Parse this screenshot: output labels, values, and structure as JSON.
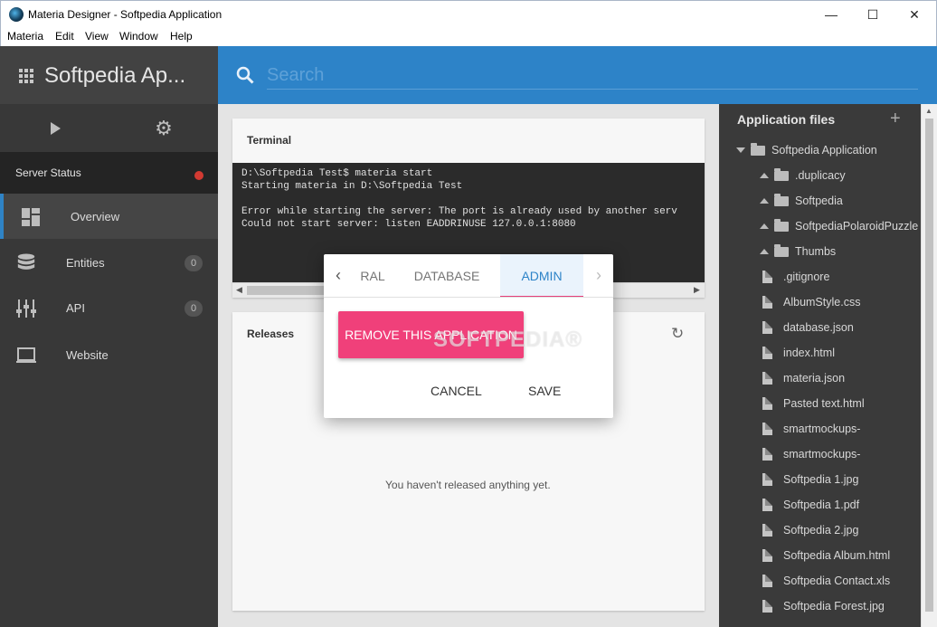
{
  "window": {
    "title": "Materia Designer - Softpedia Application",
    "controls": {
      "minimize": "—",
      "maximize": "☐",
      "close": "✕"
    }
  },
  "menu": [
    "Materia",
    "Edit",
    "View",
    "Window",
    "Help"
  ],
  "sidebar": {
    "app_title": "Softpedia Ap...",
    "server_status_label": "Server Status",
    "server_status_color": "#d23a32",
    "items": [
      {
        "label": "Overview",
        "icon": "dashboard-icon",
        "active": true
      },
      {
        "label": "Entities",
        "icon": "database-icon",
        "badge": "0"
      },
      {
        "label": "API",
        "icon": "api-icon",
        "badge": "0"
      },
      {
        "label": "Website",
        "icon": "monitor-icon"
      }
    ]
  },
  "search": {
    "placeholder": "Search"
  },
  "terminal": {
    "title": "Terminal",
    "lines": [
      "D:\\Softpedia Test$ materia start",
      "Starting materia in D:\\Softpedia Test",
      "",
      "Error while starting the server: The port is already used by another serv",
      "Could not start server: listen EADDRINUSE 127.0.0.1:8080"
    ]
  },
  "releases": {
    "title": "Releases",
    "empty_text": "You haven't released anything yet."
  },
  "files": {
    "title": "Application files",
    "tree": [
      {
        "name": "Softpedia Application",
        "type": "folder",
        "level": 0,
        "expanded": true
      },
      {
        "name": ".duplicacy",
        "type": "folder",
        "level": 1
      },
      {
        "name": "Softpedia",
        "type": "folder",
        "level": 1
      },
      {
        "name": "SoftpediaPolaroidPuzzle",
        "type": "folder",
        "level": 1
      },
      {
        "name": "Thumbs",
        "type": "folder",
        "level": 1
      },
      {
        "name": ".gitignore",
        "type": "file",
        "level": 1
      },
      {
        "name": "AlbumStyle.css",
        "type": "file",
        "level": 1
      },
      {
        "name": "database.json",
        "type": "file",
        "level": 1
      },
      {
        "name": "index.html",
        "type": "file",
        "level": 1
      },
      {
        "name": "materia.json",
        "type": "file",
        "level": 1
      },
      {
        "name": "Pasted text.html",
        "type": "file",
        "level": 1
      },
      {
        "name": "smartmockups-",
        "type": "file",
        "level": 1
      },
      {
        "name": "smartmockups-",
        "type": "file",
        "level": 1
      },
      {
        "name": "Softpedia 1.jpg",
        "type": "file",
        "level": 1
      },
      {
        "name": "Softpedia 1.pdf",
        "type": "file",
        "level": 1
      },
      {
        "name": "Softpedia 2.jpg",
        "type": "file",
        "level": 1
      },
      {
        "name": "Softpedia Album.html",
        "type": "file",
        "level": 1
      },
      {
        "name": "Softpedia Contact.xls",
        "type": "file",
        "level": 1
      },
      {
        "name": "Softpedia Forest.jpg",
        "type": "file",
        "level": 1
      }
    ]
  },
  "dialog": {
    "tabs": [
      "RAL",
      "DATABASE",
      "ADMIN"
    ],
    "active_tab": "ADMIN",
    "remove_label": "REMOVE THIS APPLICATION",
    "cancel_label": "CANCEL",
    "save_label": "SAVE",
    "accent_color": "#f0407a",
    "watermark": "SOFTPEDIA®"
  }
}
